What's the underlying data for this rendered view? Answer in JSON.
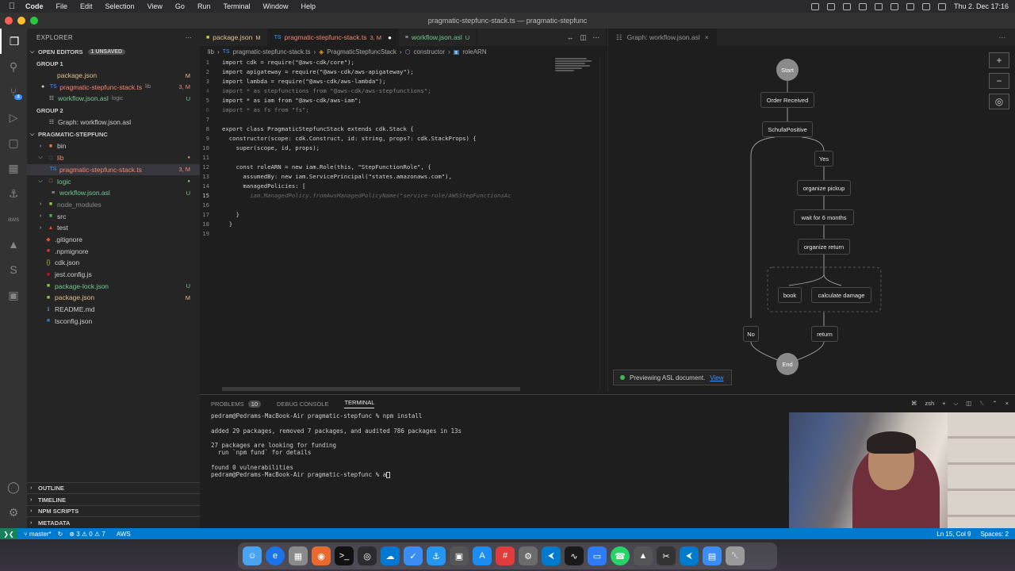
{
  "menubar": {
    "app": "Code",
    "items": [
      "File",
      "Edit",
      "Selection",
      "View",
      "Go",
      "Run",
      "Terminal",
      "Window",
      "Help"
    ],
    "clock": "Thu 2. Dec 17:16"
  },
  "window": {
    "title": "pragmatic-stepfunc-stack.ts — pragmatic-stepfunc"
  },
  "activity": {
    "scm_badge": "4"
  },
  "sidebar": {
    "header": "EXPLORER",
    "open_editors": {
      "label": "OPEN EDITORS",
      "badge": "1 UNSAVED"
    },
    "group1": "GROUP 1",
    "group1_files": [
      {
        "name": "package.json",
        "status": "M"
      },
      {
        "name": "pragmatic-stepfunc-stack.ts",
        "folder": "lib",
        "status": "3, M"
      },
      {
        "name": "workflow.json.asl",
        "folder": "logic",
        "status": "U"
      }
    ],
    "group2": "GROUP 2",
    "group2_files": [
      {
        "name": "Graph: workflow.json.asl"
      }
    ],
    "project": "PRAGMATIC-STEPFUNC",
    "tree": [
      {
        "name": "bin",
        "status": ""
      },
      {
        "name": "lib",
        "status": ""
      },
      {
        "name": "pragmatic-stepfunc-stack.ts",
        "status": "3, M"
      },
      {
        "name": "logic",
        "status": ""
      },
      {
        "name": "workflow.json.asl",
        "status": "U"
      },
      {
        "name": "node_modules",
        "status": ""
      },
      {
        "name": "src",
        "status": ""
      },
      {
        "name": "test",
        "status": ""
      },
      {
        "name": ".gitignore",
        "status": ""
      },
      {
        "name": ".npmignore",
        "status": ""
      },
      {
        "name": "cdk.json",
        "status": ""
      },
      {
        "name": "jest.config.js",
        "status": ""
      },
      {
        "name": "package-lock.json",
        "status": "U"
      },
      {
        "name": "package.json",
        "status": "M"
      },
      {
        "name": "README.md",
        "status": ""
      },
      {
        "name": "tsconfig.json",
        "status": ""
      }
    ],
    "bottom_sections": [
      "OUTLINE",
      "TIMELINE",
      "NPM SCRIPTS",
      "METADATA"
    ]
  },
  "tabs": [
    {
      "label": "package.json",
      "flag": "M"
    },
    {
      "label": "pragmatic-stepfunc-stack.ts",
      "flag": "3, M"
    },
    {
      "label": "workflow.json.asl",
      "flag": "U"
    }
  ],
  "breadcrumb": [
    "lib",
    "pragmatic-stepfunc-stack.ts",
    "PragmaticStepfuncStack",
    "constructor",
    "roleARN"
  ],
  "code": {
    "l1": "import cdk = require(\"@aws-cdk/core\");",
    "l2": "import apigateway = require(\"@aws-cdk/aws-apigateway\");",
    "l3": "import lambda = require(\"@aws-cdk/aws-lambda\");",
    "l4": "import * as stepfunctions from \"@aws-cdk/aws-stepfunctions\";",
    "l5": "import * as iam from \"@aws-cdk/aws-iam\";",
    "l6": "import * as fs from \"fs\";",
    "l8": "export class PragmaticStepfuncStack extends cdk.Stack {",
    "l9": "  constructor(scope: cdk.Construct, id: string, props?: cdk.StackProps) {",
    "l10": "    super(scope, id, props);",
    "l12": "    const roleARN = new iam.Role(this, \"StepFunctionRole\", {",
    "l13": "      assumedBy: new iam.ServicePrincipal(\"states.amazonaws.com\"),",
    "l14": "      managedPolicies: [",
    "l15": "        iam.ManagedPolicy.fromAwsManagedPolicyName(\"service-role/AWSStepFunctionsAc",
    "l17": "    }",
    "l18": "  }",
    "l19": ""
  },
  "graph": {
    "tab": "Graph: workflow.json.asl",
    "nodes": {
      "start": "Start",
      "order_received": "Order Received",
      "schufa": "SchufaPositive",
      "yes": "Yes",
      "pickup": "organize pickup",
      "wait": "wait for 6 months",
      "return_org": "organize return",
      "book": "book",
      "damage": "calculate damage",
      "no": "No",
      "return": "return",
      "end": "End"
    },
    "preview_text": "Previewing ASL document.",
    "preview_link": "View"
  },
  "panel": {
    "tabs": {
      "problems": "PROBLEMS",
      "problems_count": "10",
      "debug": "DEBUG CONSOLE",
      "terminal": "TERMINAL"
    },
    "shell": "zsh",
    "terminal_lines": [
      "pedram@Pedrams-MacBook-Air pragmatic-stepfunc % npm install",
      "",
      "added 29 packages, removed 7 packages, and audited 786 packages in 13s",
      "",
      "27 packages are looking for funding",
      "  run `npm fund` for details",
      "",
      "found 0 vulnerabilities",
      "pedram@Pedrams-MacBook-Air pragmatic-stepfunc % a"
    ]
  },
  "statusbar": {
    "branch": "master*",
    "problems": "⊗ 3 ⚠ 0 ⚠ 7",
    "aws": "AWS",
    "position": "Ln 15, Col 9",
    "spaces": "Spaces: 2"
  }
}
